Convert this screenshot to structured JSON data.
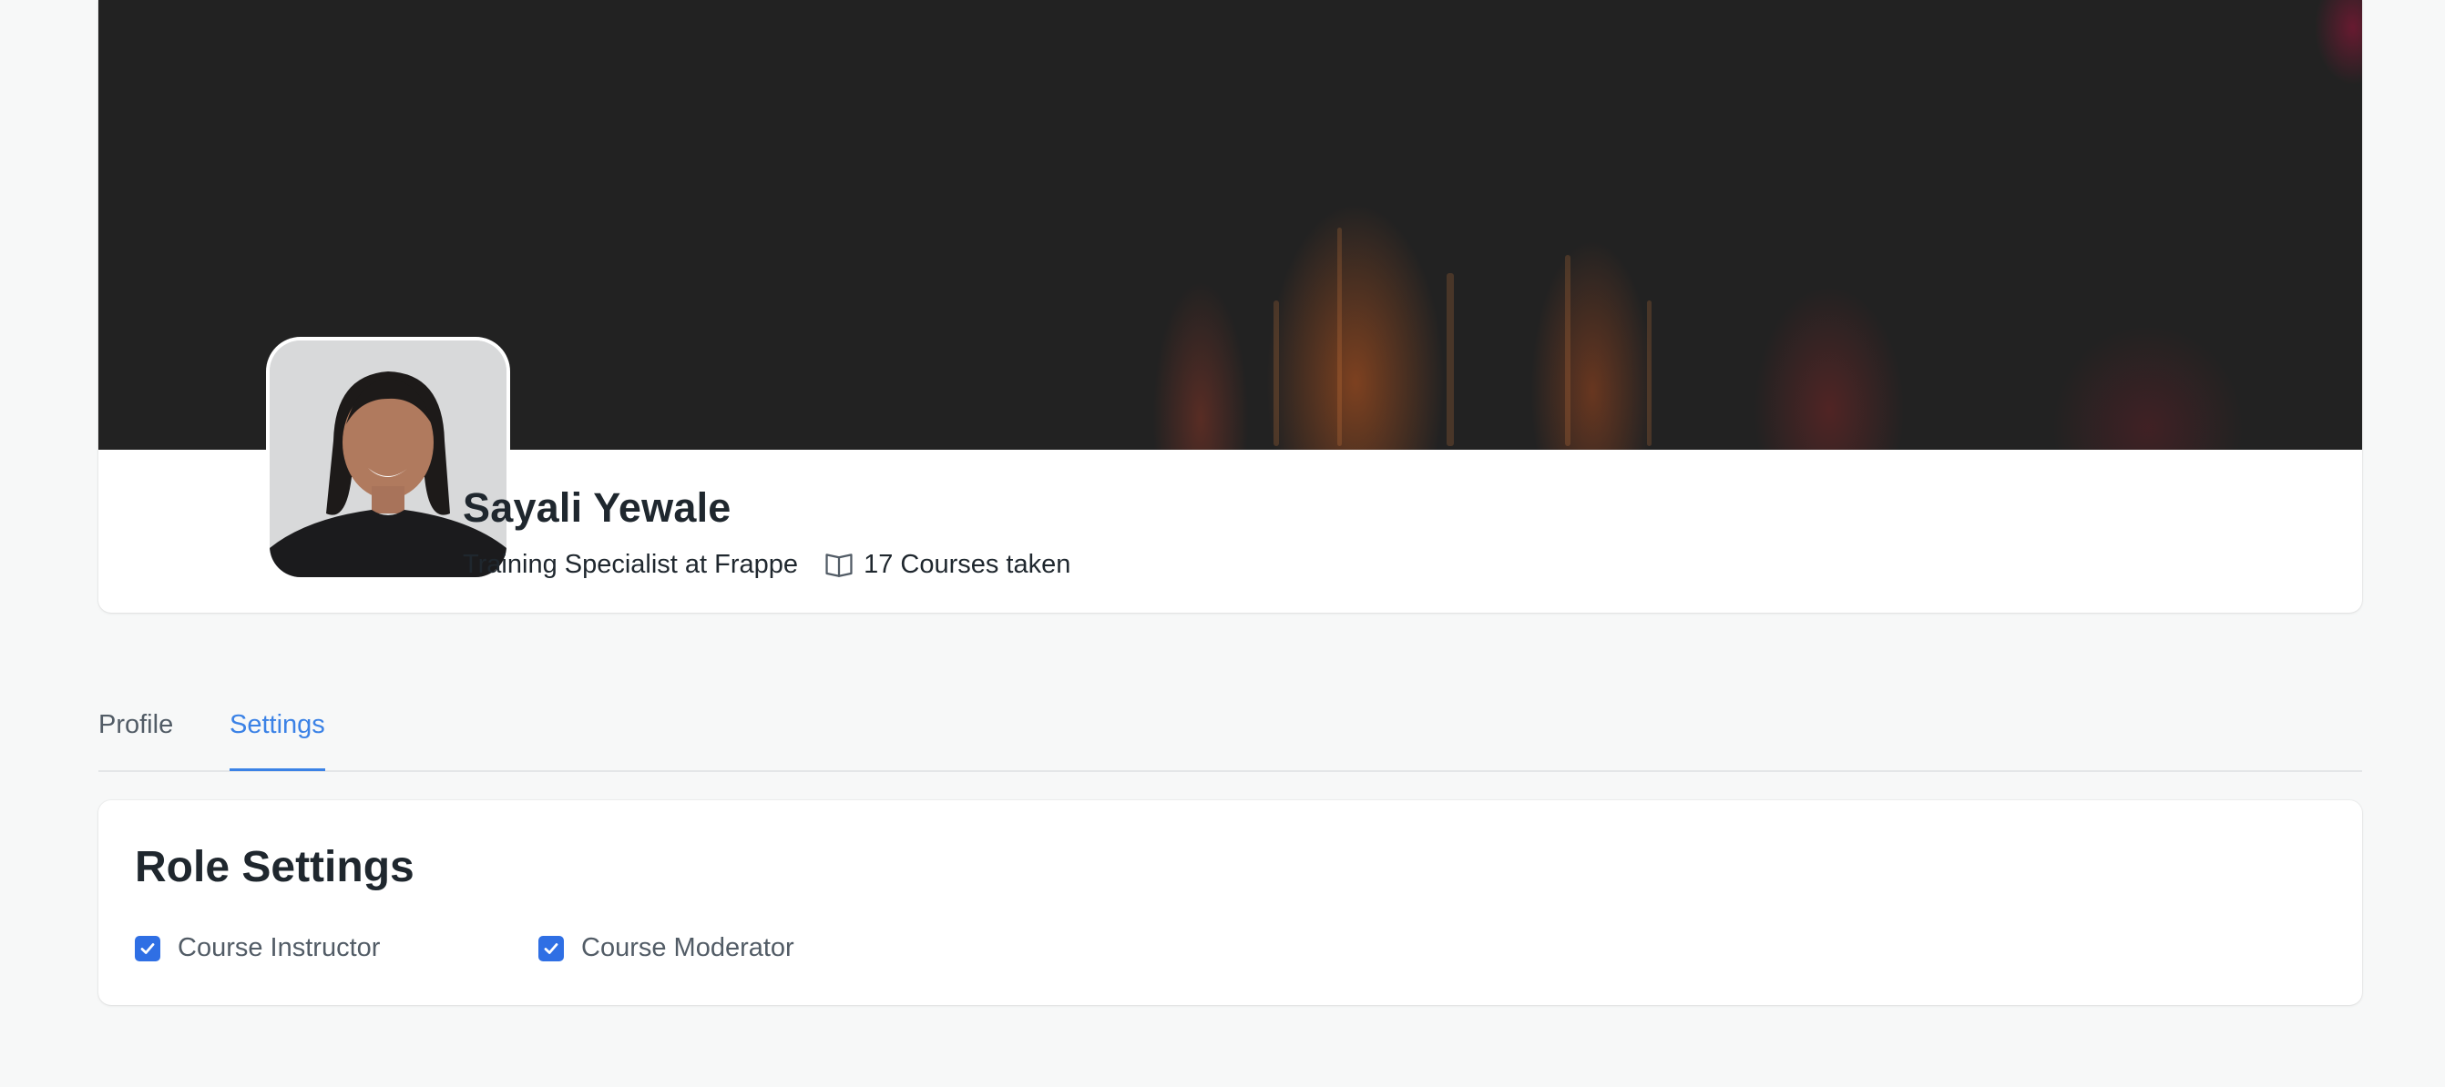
{
  "user": {
    "name": "Sayali Yewale",
    "headline": "Training Specialist at Frappe",
    "courses_taken": "17 Courses taken"
  },
  "icons": {
    "courses": "book-open-icon",
    "checkbox": "checkmark-icon"
  },
  "tabs": [
    {
      "label": "Profile",
      "active": false
    },
    {
      "label": "Settings",
      "active": true
    }
  ],
  "role_settings": {
    "title": "Role Settings",
    "options": [
      {
        "label": "Course Instructor",
        "checked": true
      },
      {
        "label": "Course Moderator",
        "checked": true
      }
    ]
  },
  "colors": {
    "accent": "#3b82e6",
    "checkbox": "#2f6fe4",
    "cover": "#222222",
    "background": "#f7f8f8"
  }
}
